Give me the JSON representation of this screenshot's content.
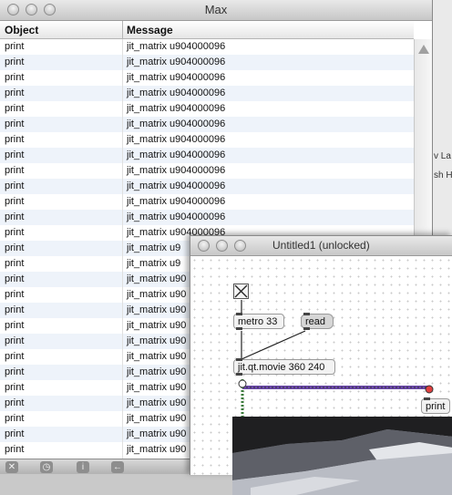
{
  "max_window": {
    "title": "Max",
    "columns": [
      "Object",
      "Message"
    ],
    "rows": [
      {
        "object": "print",
        "message": "jit_matrix u904000096"
      },
      {
        "object": "print",
        "message": "jit_matrix u904000096"
      },
      {
        "object": "print",
        "message": "jit_matrix u904000096"
      },
      {
        "object": "print",
        "message": "jit_matrix u904000096"
      },
      {
        "object": "print",
        "message": "jit_matrix u904000096"
      },
      {
        "object": "print",
        "message": "jit_matrix u904000096"
      },
      {
        "object": "print",
        "message": "jit_matrix u904000096"
      },
      {
        "object": "print",
        "message": "jit_matrix u904000096"
      },
      {
        "object": "print",
        "message": "jit_matrix u904000096"
      },
      {
        "object": "print",
        "message": "jit_matrix u904000096"
      },
      {
        "object": "print",
        "message": "jit_matrix u904000096"
      },
      {
        "object": "print",
        "message": "jit_matrix u904000096"
      },
      {
        "object": "print",
        "message": "jit_matrix u904000096"
      },
      {
        "object": "print",
        "message": "jit_matrix u9"
      },
      {
        "object": "print",
        "message": "jit_matrix u9"
      },
      {
        "object": "print",
        "message": "jit_matrix u90"
      },
      {
        "object": "print",
        "message": "jit_matrix u90"
      },
      {
        "object": "print",
        "message": "jit_matrix u90"
      },
      {
        "object": "print",
        "message": "jit_matrix u90"
      },
      {
        "object": "print",
        "message": "jit_matrix u90"
      },
      {
        "object": "print",
        "message": "jit_matrix u90"
      },
      {
        "object": "print",
        "message": "jit_matrix u90"
      },
      {
        "object": "print",
        "message": "jit_matrix u90"
      },
      {
        "object": "print",
        "message": "jit_matrix u90"
      },
      {
        "object": "print",
        "message": "jit_matrix u90"
      },
      {
        "object": "print",
        "message": "jit_matrix u90"
      },
      {
        "object": "print",
        "message": "jit_matrix u90"
      }
    ],
    "toolbar_icons": [
      "clear-icon",
      "clock-icon",
      "info-icon",
      "back-arrow-icon"
    ],
    "toolbar_glyphs": [
      "✕",
      "◷",
      "i",
      "←"
    ]
  },
  "background_window": {
    "text_lines": [
      "v La",
      "sh H"
    ]
  },
  "patcher": {
    "title": "Untitled1 (unlocked)",
    "objects": {
      "metro": "metro 33",
      "read": "read",
      "movie": "jit.qt.movie 360 240",
      "print": "print"
    }
  },
  "colors": {
    "row_alt": "#eef3fa",
    "matrix_cord": "#6a48a8",
    "cord": "#222222"
  }
}
